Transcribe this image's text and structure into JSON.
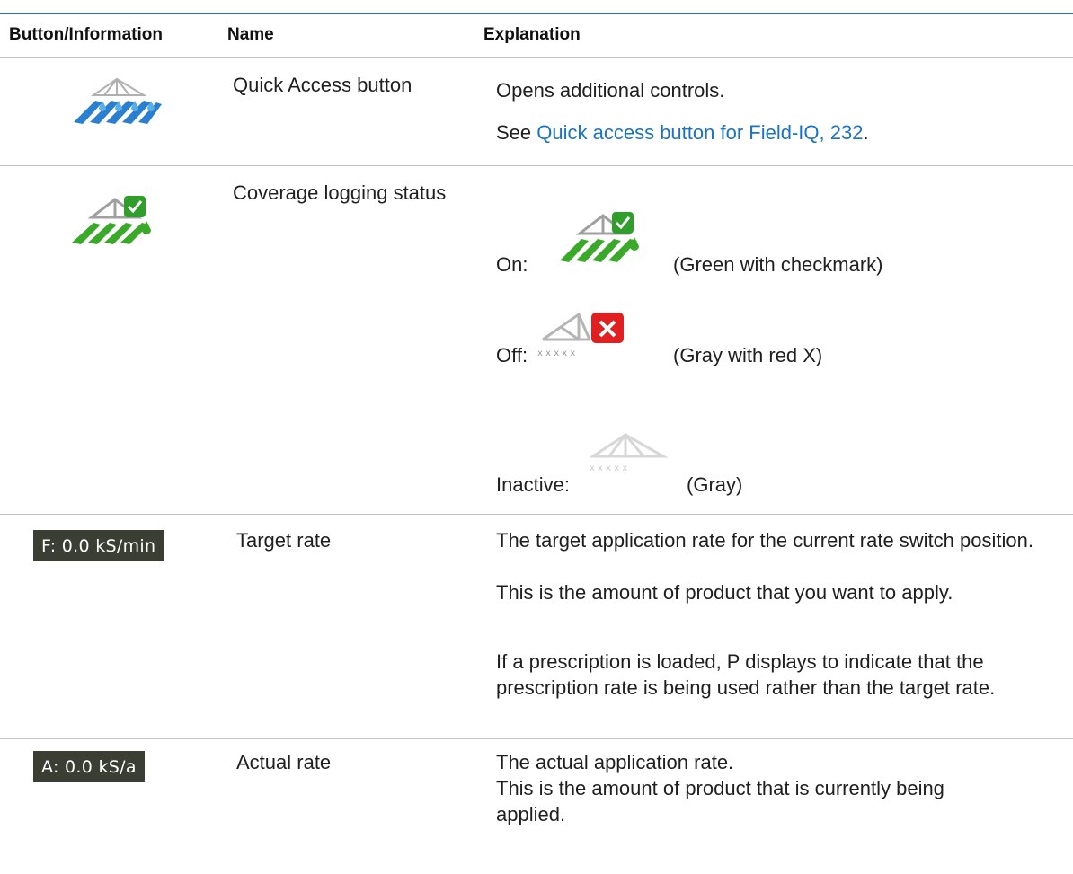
{
  "header": {
    "col1": "Button/Information",
    "col2": "Name",
    "col3": "Explanation"
  },
  "rows": {
    "quick_access": {
      "icon": "quick-access-boom-icon",
      "name": "Quick Access button",
      "text": "Opens additional controls.",
      "see_prefix": "See ",
      "see_link": "Quick access button for Field-IQ, 232",
      "see_suffix": "."
    },
    "coverage": {
      "icon": "coverage-logging-on-icon",
      "name": "Coverage logging status",
      "on_label": "On:",
      "on_desc": "(Green with checkmark)",
      "off_label": "Off:",
      "off_desc": "(Gray with red X)",
      "inactive_label": "Inactive:",
      "inactive_desc": "(Gray)"
    },
    "target": {
      "status": "F: 0.0 kS/min",
      "name": "Target rate",
      "line1": "The target application rate for the current rate switch position.",
      "line2": "This is the amount of product that you want to apply.",
      "line3": "If a prescription is loaded, P displays to indicate that the prescription rate is being used rather than the target rate."
    },
    "actual": {
      "status": "A: 0.0 kS/a",
      "name": "Actual rate",
      "line1": "The actual application rate.",
      "line2": "This is the amount of product that is currently being applied."
    }
  },
  "colors": {
    "link": "#1a73c8",
    "status_bg": "#3b3f33",
    "green": "#3aa92a",
    "red": "#e02020",
    "blue": "#2a7fd0"
  }
}
